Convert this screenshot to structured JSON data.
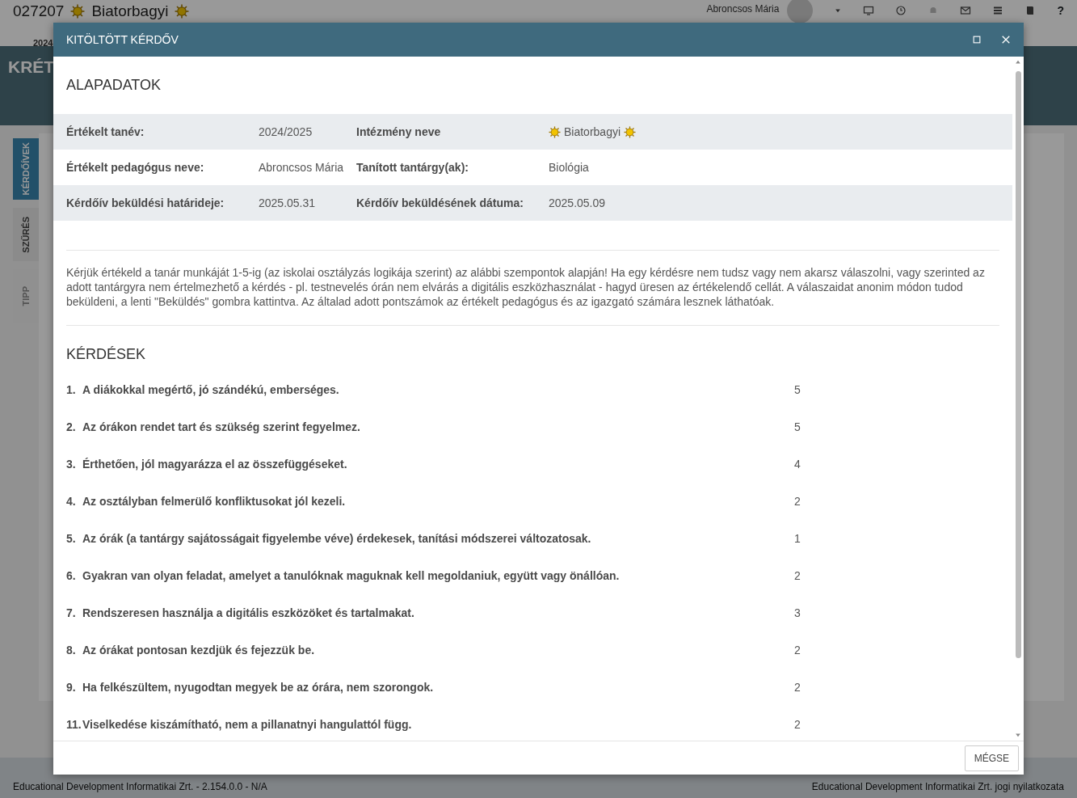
{
  "background_page": {
    "code": "027207",
    "institution": "Biatorbagyi",
    "year": "2024",
    "user_name": "Abroncsos Mária",
    "logo": "KRÉT",
    "help": "?",
    "side_tabs": [
      {
        "label": "KÉRDŐÍVEK",
        "selected": true
      },
      {
        "label": "SZŰRÉS",
        "selected": false
      },
      {
        "label": "TIPP",
        "selected": false,
        "disabled": true
      }
    ],
    "footer_left": "Educational Development Informatikai Zrt. - 2.154.0.0 - N/A",
    "footer_right": "Educational Development Informatikai Zrt. jogi nyilatkozata"
  },
  "modal": {
    "title": "KITÖLTÖTT KÉRDŐV",
    "section_title": "ALAPADATOK",
    "info_rows": [
      {
        "label_1": "Értékelt tanév:",
        "value_1": "2024/2025",
        "label_2": "Intézmény neve",
        "value_2": "Biatorbagyi",
        "value_2_sun_icons": true
      },
      {
        "label_1": "Értékelt pedagógus neve:",
        "value_1": "Abroncsos Mária",
        "label_2": "Tanított tantárgy(ak):",
        "value_2": "Biológia",
        "value_2_sun_icons": false
      },
      {
        "label_1": "Kérdőív beküldési határideje:",
        "value_1": "2025.05.31",
        "label_2": "Kérdőív beküldésének dátuma:",
        "value_2": "2025.05.09",
        "value_2_sun_icons": false
      }
    ],
    "instructions": "Kérjük értékeld a tanár munkáját 1-5-ig (az iskolai osztályzás logikája szerint) az alábbi szempontok alapján! Ha egy kérdésre nem tudsz vagy nem akarsz válaszolni, vagy szerinted az adott tantárgyra nem értelmezhető a kérdés - pl. testnevelés órán nem elvárás a digitális eszközhasználat - hagyd üresen az értékelendő cellát. A válaszaidat anonim módon tudod beküldeni, a lenti \"Beküldés\" gombra kattintva. Az általad adott pontszámok az értékelt pedagógus és az igazgató számára lesznek láthatóak.",
    "questions_title": "KÉRDÉSEK",
    "questions": [
      {
        "number": "1.",
        "text": "A diákokkal megértő, jó szándékú, emberséges.",
        "score": "5"
      },
      {
        "number": "2.",
        "text": "Az órákon rendet tart és szükség szerint fegyelmez.",
        "score": "5"
      },
      {
        "number": "3.",
        "text": "Érthetően, jól magyarázza el az összefüggéseket.",
        "score": "4"
      },
      {
        "number": "4.",
        "text": "Az osztályban felmerülő konfliktusokat jól kezeli.",
        "score": "2"
      },
      {
        "number": "5.",
        "text": "Az órák (a tantárgy sajátosságait figyelembe véve) érdekesek, tanítási módszerei változatosak.",
        "score": "1"
      },
      {
        "number": "6.",
        "text": "Gyakran van olyan feladat, amelyet a tanulóknak maguknak kell megoldaniuk, együtt vagy önállóan.",
        "score": "2"
      },
      {
        "number": "7.",
        "text": "Rendszeresen használja a digitális eszközöket és tartalmakat.",
        "score": "3"
      },
      {
        "number": "8.",
        "text": "Az órákat pontosan kezdjük és fejezzük be.",
        "score": "2"
      },
      {
        "number": "9.",
        "text": "Ha felkészültem, nyugodtan megyek be az órára, nem szorongok.",
        "score": "2"
      },
      {
        "number": "11.",
        "text": "Viselkedése kiszámítható, nem a pillanatnyi hangulattól függ.",
        "score": "2"
      }
    ],
    "cancel_button": "MÉGSE"
  }
}
